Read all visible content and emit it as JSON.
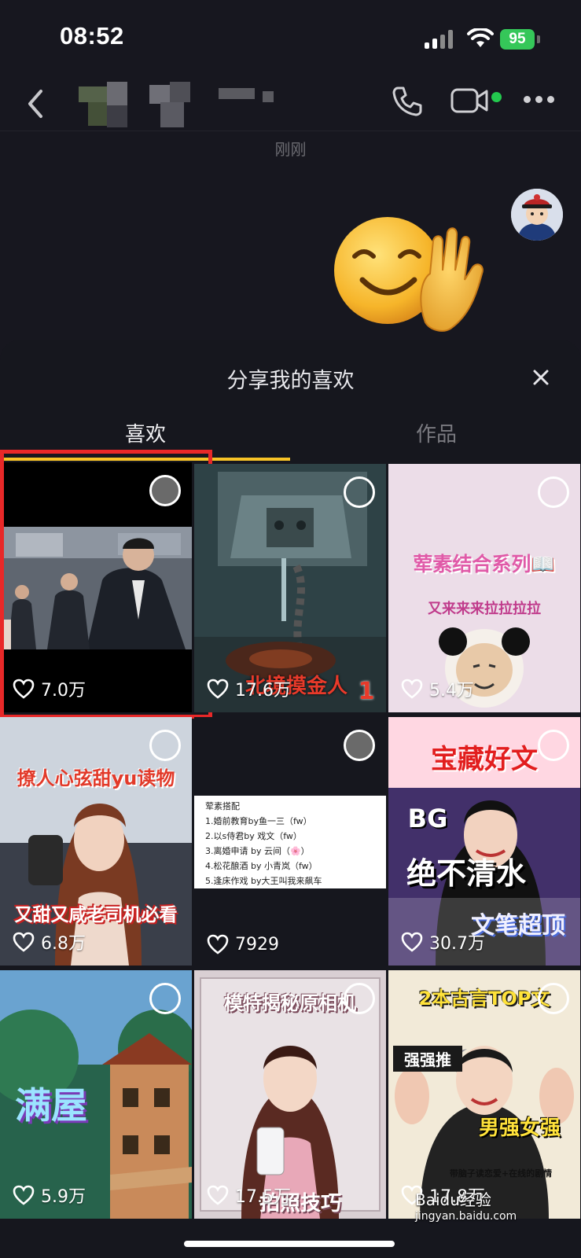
{
  "status_bar": {
    "time": "08:52",
    "battery": "95"
  },
  "chat": {
    "timestamp": "刚刚"
  },
  "share_sheet": {
    "title": "分享我的喜欢",
    "tabs": [
      {
        "label": "喜欢"
      },
      {
        "label": "作品"
      }
    ]
  },
  "tiles": [
    {
      "likes": "7.0万",
      "selected": true
    },
    {
      "likes": "17.6万",
      "caption": "北境摸金人",
      "badge": "1"
    },
    {
      "likes": "5.4万",
      "caption": "荤素结合系列📖",
      "subcaption": "又来来来拉拉拉拉"
    },
    {
      "likes": "6.8万",
      "caption": "撩人心弦甜yu读物",
      "subcaption": "又甜又咸老司机必看"
    },
    {
      "likes": "7929",
      "list_title": "荤素搭配",
      "list": [
        "1.婚前教育by鱼一三（fw）",
        "2.以s侍君by 戏文（fw）",
        "3.离婚申请 by 云间（🌸）",
        "4.松花酿酒 by 小青岚（fw）",
        "5.逢床作戏 by大王叫我来飙车"
      ]
    },
    {
      "likes": "30.7万",
      "caption": "宝藏好文",
      "subcaption": "BG",
      "caption2": "绝不清水",
      "caption3": "文笔超顶"
    },
    {
      "likes": "5.9万",
      "caption": "满屋"
    },
    {
      "likes": "17.5万",
      "caption": "模特揭秘原相机",
      "subcaption": "拍照技巧"
    },
    {
      "likes": "17.8万",
      "caption": "2本古言TOP文",
      "subcaption": "强强推",
      "caption2": "男强女强",
      "caption3": "带脑子读恋爱+在线的剧情"
    }
  ],
  "watermark": {
    "brand": "Baidu经验",
    "url": "jingyan.baidu.com"
  }
}
